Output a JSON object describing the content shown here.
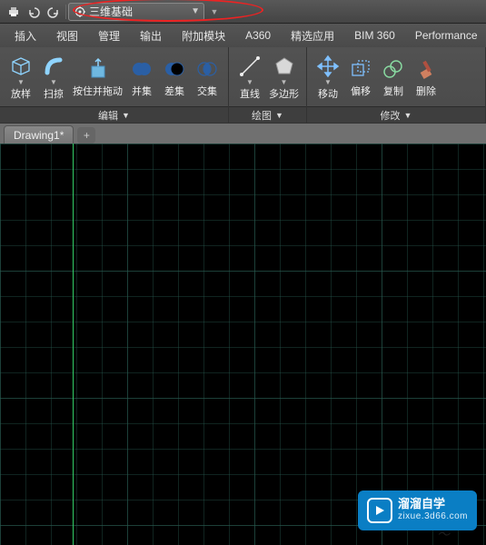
{
  "workspace": {
    "label": "三维基础"
  },
  "menu": {
    "items": [
      "插入",
      "视图",
      "管理",
      "输出",
      "附加模块",
      "A360",
      "精选应用",
      "BIM 360",
      "Performance"
    ]
  },
  "ribbon": {
    "panels": [
      {
        "title": "编辑",
        "buttons": [
          {
            "name": "extrude",
            "label": "放样"
          },
          {
            "name": "sweep",
            "label": "扫掠"
          },
          {
            "name": "presspull",
            "label": "按住并拖动"
          },
          {
            "name": "union",
            "label": "并集"
          },
          {
            "name": "subtract",
            "label": "差集"
          },
          {
            "name": "intersect",
            "label": "交集"
          }
        ]
      },
      {
        "title": "绘图",
        "buttons": [
          {
            "name": "line",
            "label": "直线"
          },
          {
            "name": "polygon",
            "label": "多边形"
          }
        ]
      },
      {
        "title": "修改",
        "buttons": [
          {
            "name": "move",
            "label": "移动"
          },
          {
            "name": "offset",
            "label": "偏移"
          },
          {
            "name": "copy",
            "label": "复制"
          },
          {
            "name": "delete",
            "label": "删除"
          }
        ]
      }
    ]
  },
  "tabs": {
    "active": "Drawing1*"
  },
  "watermark": {
    "title": "溜溜自学",
    "url": "zixue.3d66.com"
  }
}
